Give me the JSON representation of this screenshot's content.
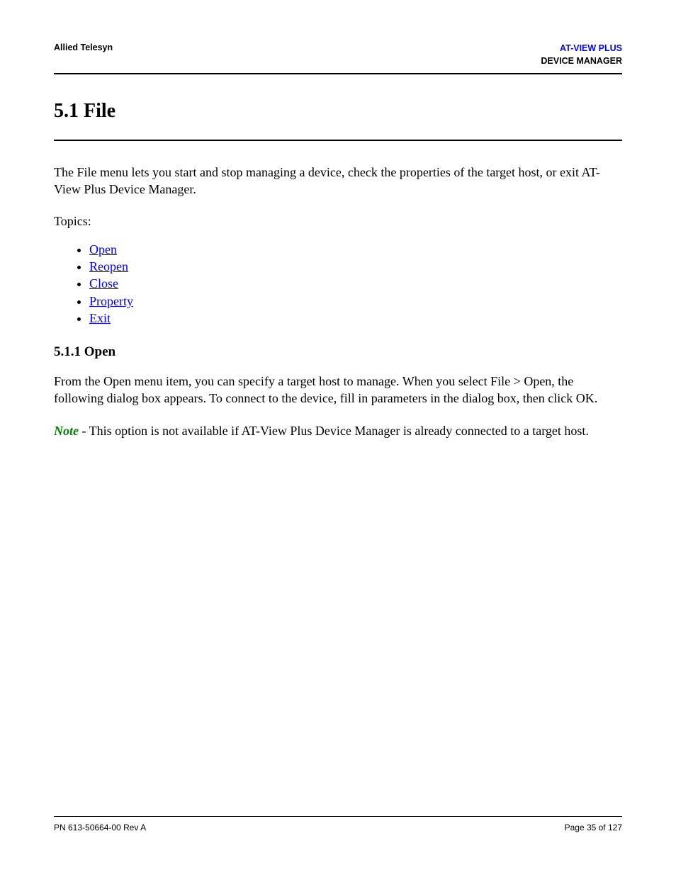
{
  "header": {
    "left": "Allied Telesyn",
    "right_line1": "AT-VIEW PLUS",
    "right_line2": "DEVICE MANAGER"
  },
  "section": {
    "title": "5.1 File",
    "intro": "The File menu lets you start and stop managing a device, check the properties of the target host, or exit AT-View Plus Device Manager.",
    "topics_label": "Topics:",
    "topics": [
      {
        "label": "Open"
      },
      {
        "label": "Reopen"
      },
      {
        "label": "Close"
      },
      {
        "label": "Property"
      },
      {
        "label": "Exit"
      }
    ]
  },
  "subsection": {
    "title": "5.1.1 Open",
    "para1": "From the Open menu item, you can specify a target host to manage. When you select File > Open, the following dialog box appears. To connect to the device, fill in parameters in the dialog box, then click OK.",
    "note_label": "Note",
    "note_text": " - This option is not available if AT-View Plus Device Manager is already connected to a target host."
  },
  "footer": {
    "left": "PN 613-50664-00 Rev A",
    "right": "Page 35 of 127"
  }
}
